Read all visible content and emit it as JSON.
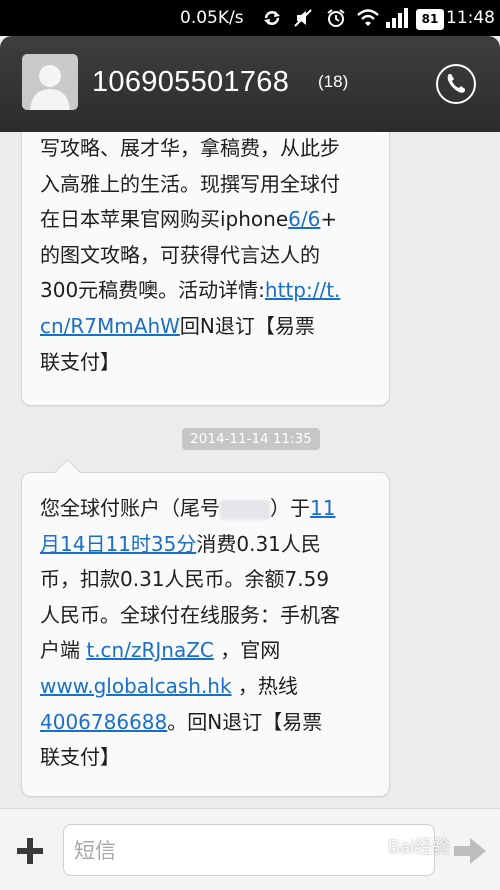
{
  "status_bar": {
    "speed": "0.05K/s",
    "battery": "81",
    "time": "11:48",
    "icons": [
      "sync-icon",
      "mute-icon",
      "alarm-icon",
      "wifi-icon",
      "signal-icon",
      "battery-icon"
    ]
  },
  "header": {
    "contact_number": "106905501768",
    "message_count": "(18)",
    "icons": [
      "avatar-icon",
      "phone-icon"
    ]
  },
  "messages": [
    {
      "lines": [
        [
          {
            "text": "写攻略、展才华，拿稿费，从此步"
          }
        ],
        [
          {
            "text": "入高雅上的生活。现撰写用全球付"
          }
        ],
        [
          {
            "text": "在日本苹果官网购买iphone"
          },
          {
            "text": "6/6",
            "link": true
          },
          {
            "text": "+"
          }
        ],
        [
          {
            "text": "的图文攻略，可获得代言达人的"
          }
        ],
        [
          {
            "text": "300元稿费噢。活动详情:"
          },
          {
            "text": "http://t.",
            "link": true
          }
        ],
        [
          {
            "text": "cn/R7MmAhW",
            "link": true
          },
          {
            "text": "回N退订【易票"
          }
        ],
        [
          {
            "text": "联支付】"
          }
        ]
      ]
    },
    {
      "timestamp": "2014-11-14 11:35",
      "lines": [
        [
          {
            "text": "您全球付账户（尾号"
          },
          {
            "masked": true
          },
          {
            "text": "）于"
          },
          {
            "text": "11",
            "link": true
          }
        ],
        [
          {
            "text": "月14日11时35分",
            "link": true
          },
          {
            "text": "消费0.31人民"
          }
        ],
        [
          {
            "text": "币，扣款0.31人民币。余额7.59"
          }
        ],
        [
          {
            "text": "人民币。全球付在线服务：手机客"
          }
        ],
        [
          {
            "text": "户端 "
          },
          {
            "text": "t.cn/zRJnaZC",
            "link": true
          },
          {
            "text": " ，官网"
          }
        ],
        [
          {
            "text": "www.globalcash.hk",
            "link": true
          },
          {
            "text": " ，热线"
          }
        ],
        [
          {
            "text": "4006786688",
            "link": true
          },
          {
            "text": "。回N退订【易票"
          }
        ],
        [
          {
            "text": "联支付】"
          }
        ]
      ]
    }
  ],
  "compose": {
    "placeholder": "短信",
    "icons": [
      "add-icon",
      "send-icon"
    ]
  },
  "watermark": "Bai经验",
  "colors": {
    "link": "#1a6fc9",
    "header_bg": "#333333",
    "bubble_bg": "#fafafa",
    "timestamp_bg": "#c6c6c6"
  }
}
